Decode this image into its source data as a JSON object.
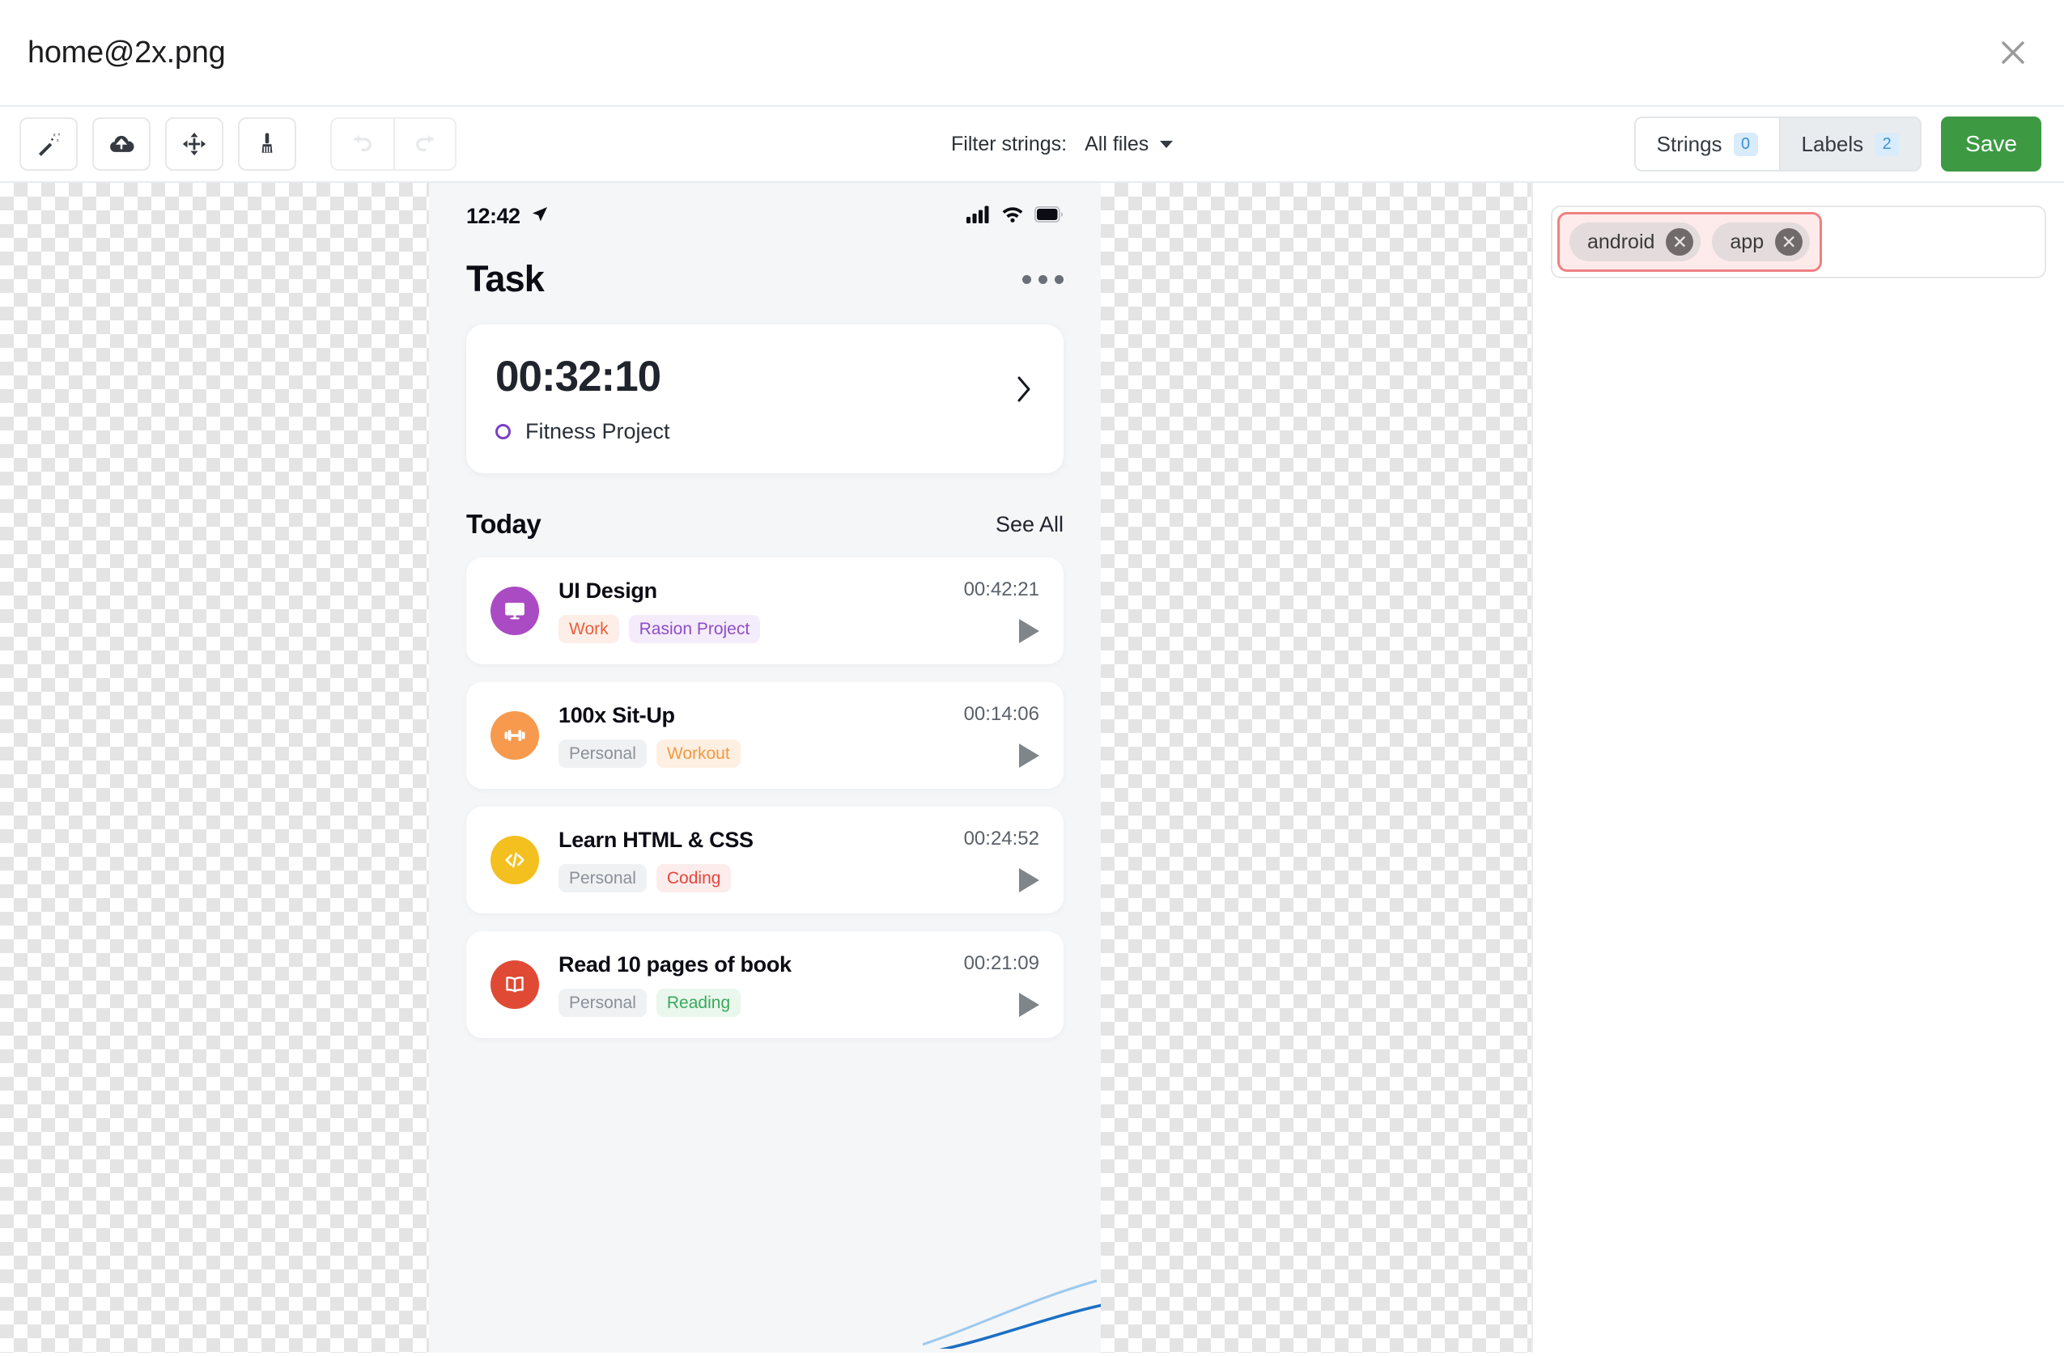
{
  "window": {
    "file_title": "home@2x.png",
    "close_icon": "close-icon"
  },
  "toolbar": {
    "tools": [
      {
        "name": "magic-wand-icon",
        "label": "Magic wand"
      },
      {
        "name": "cloud-upload-icon",
        "label": "Upload"
      },
      {
        "name": "move-icon",
        "label": "Move"
      },
      {
        "name": "brush-icon",
        "label": "Brush"
      }
    ],
    "undo_label": "Undo",
    "redo_label": "Redo",
    "filter_label": "Filter strings:",
    "filter_value": "All files",
    "tabs": [
      {
        "label": "Strings",
        "count": "0",
        "active": false
      },
      {
        "label": "Labels",
        "count": "2",
        "active": true
      }
    ],
    "save_label": "Save"
  },
  "labels_panel": {
    "tags": [
      {
        "text": "android",
        "remove_icon": "✕"
      },
      {
        "text": "app",
        "remove_icon": "✕"
      }
    ]
  },
  "screenshot": {
    "status_bar": {
      "time": "12:42",
      "location_icon": "location-arrow-icon",
      "signal_icon": "cellular-signal-icon",
      "wifi_icon": "wifi-icon",
      "battery_icon": "battery-icon"
    },
    "header": {
      "title": "Task",
      "menu_icon": "more-options-icon"
    },
    "timer_card": {
      "value": "00:32:10",
      "project": "Fitness Project",
      "project_color": "#7a3fc9",
      "chevron_icon": "chevron-right-icon"
    },
    "section": {
      "title": "Today",
      "see_all": "See All"
    },
    "tasks": [
      {
        "name": "UI Design",
        "time": "00:42:21",
        "icon": "monitor-icon",
        "icon_bg": "#ab4bc4",
        "chips": [
          {
            "text": "Work",
            "bg": "#fdeee8",
            "color": "#e8603c"
          },
          {
            "text": "Rasion Project",
            "bg": "#f4ecfb",
            "color": "#8f4cc9"
          }
        ]
      },
      {
        "name": "100x Sit-Up",
        "time": "00:14:06",
        "icon": "dumbbell-icon",
        "icon_bg": "#f79a4e",
        "chips": [
          {
            "text": "Personal",
            "bg": "#f0f1f3",
            "color": "#8a9099"
          },
          {
            "text": "Workout",
            "bg": "#fdf0e3",
            "color": "#f5993f"
          }
        ]
      },
      {
        "name": "Learn HTML & CSS",
        "time": "00:24:52",
        "icon": "code-icon",
        "icon_bg": "#f3c01f",
        "chips": [
          {
            "text": "Personal",
            "bg": "#f0f1f3",
            "color": "#8a9099"
          },
          {
            "text": "Coding",
            "bg": "#fdecec",
            "color": "#e6453c"
          }
        ]
      },
      {
        "name": "Read 10 pages of book",
        "time": "00:21:09",
        "icon": "book-icon",
        "icon_bg": "#e04a35",
        "chips": [
          {
            "text": "Personal",
            "bg": "#f0f1f3",
            "color": "#8a9099"
          },
          {
            "text": "Reading",
            "bg": "#e9f7ec",
            "color": "#3aa85c"
          }
        ]
      }
    ]
  },
  "colors": {
    "save_green": "#3d9a43",
    "badge_blue": "#3b91d8",
    "highlight_red": "#f08080"
  }
}
